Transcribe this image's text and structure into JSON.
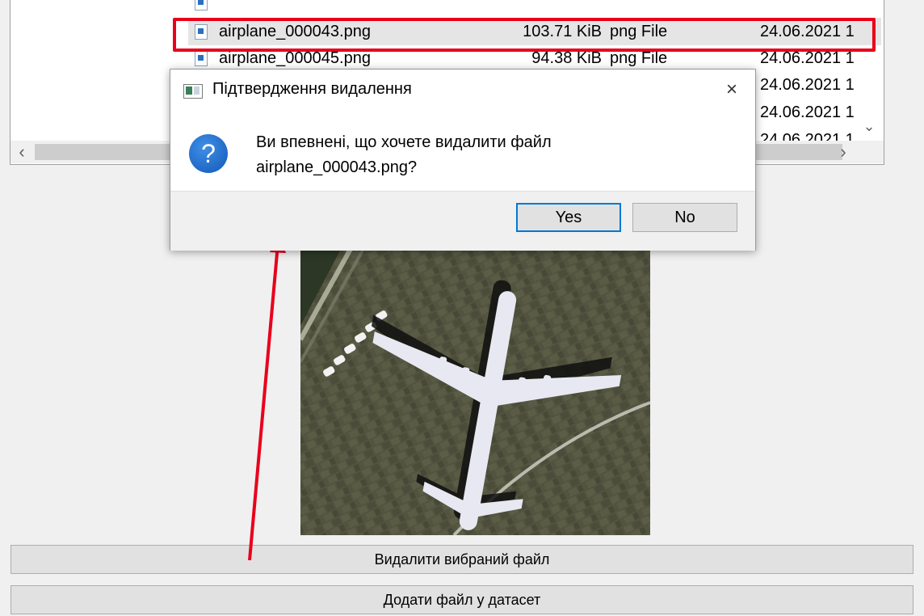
{
  "file_list": {
    "rows": [
      {
        "name": "airplane_000043.png",
        "size": "103.71 KiB",
        "type": "png File",
        "date": "24.06.2021 1",
        "selected": true
      },
      {
        "name": "airplane_000045.png",
        "size": "94.38 KiB",
        "type": "png File",
        "date": "24.06.2021 1",
        "selected": false
      },
      {
        "name": "",
        "size": "",
        "type": "",
        "date": "24.06.2021 1",
        "selected": false
      },
      {
        "name": "",
        "size": "",
        "type": "",
        "date": "24.06.2021 1",
        "selected": false
      },
      {
        "name": "",
        "size": "",
        "type": "",
        "date": "24.06.2021 1",
        "selected": false
      }
    ]
  },
  "dialog": {
    "title": "Підтвердження видалення",
    "message_line1": "Ви впевнені, що хочете видалити файл",
    "message_line2": "airplane_000043.png?",
    "yes_label": "Yes",
    "no_label": "No",
    "question_glyph": "?"
  },
  "buttons": {
    "delete_label": "Видалити вибраний файл",
    "add_label": "Додати файл у датасет"
  },
  "icons": {
    "close": "×",
    "scroll_left": "‹",
    "scroll_right": "›",
    "scroll_down": "⌄"
  },
  "colors": {
    "highlight": "#e8001c",
    "annotation_arrow": "#e8001c",
    "accent": "#0078d7"
  }
}
